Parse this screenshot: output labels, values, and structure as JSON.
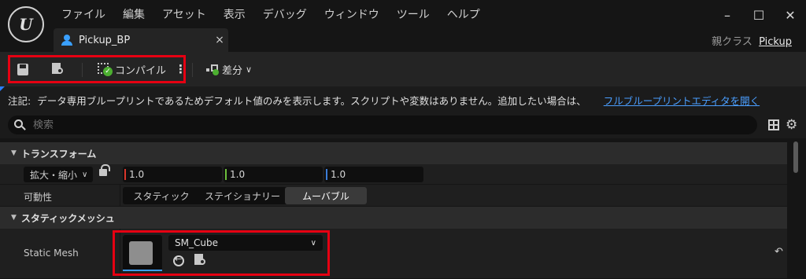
{
  "app": {
    "logo_text": "U",
    "menu": [
      "ファイル",
      "編集",
      "アセット",
      "表示",
      "デバッグ",
      "ウィンドウ",
      "ツール",
      "ヘルプ"
    ],
    "window_controls": {
      "minimize": "–",
      "maximize": "☐",
      "close": "✕"
    },
    "tab": {
      "label": "Pickup_BP",
      "close": "×"
    },
    "parent_class": {
      "label": "親クラス",
      "value": "Pickup"
    }
  },
  "toolbar": {
    "compile_label": "コンパイル",
    "more": "⋮",
    "diff_label": "差分",
    "diff_chevron": "∨"
  },
  "notice": {
    "label": "注記:",
    "text": "データ専用ブループリントであるためデフォルト値のみを表示します。スクリプトや変数はありません。追加したい場合は、",
    "link": "フルブループリントエディタを開く"
  },
  "search": {
    "placeholder": "検索"
  },
  "details": {
    "transform": {
      "header": "トランスフォーム",
      "scale": {
        "label": "拡大・縮小",
        "x": "1.0",
        "y": "1.0",
        "z": "1.0",
        "axis_colors": [
          "#d9362b",
          "#6cbf3c",
          "#3b7dd8"
        ]
      },
      "mobility": {
        "label": "可動性",
        "options": [
          "スタティック",
          "ステイショナリー",
          "ムーバブル"
        ],
        "selected": "ムーバブル"
      }
    },
    "static_mesh": {
      "header": "スタティックメッシュ",
      "label": "Static Mesh",
      "asset": "SM_Cube",
      "reset": "↶"
    }
  },
  "colors": {
    "highlight": "#e60012",
    "accent": "#3aa0ff",
    "link": "#4a9eff",
    "success": "#4caf30"
  }
}
